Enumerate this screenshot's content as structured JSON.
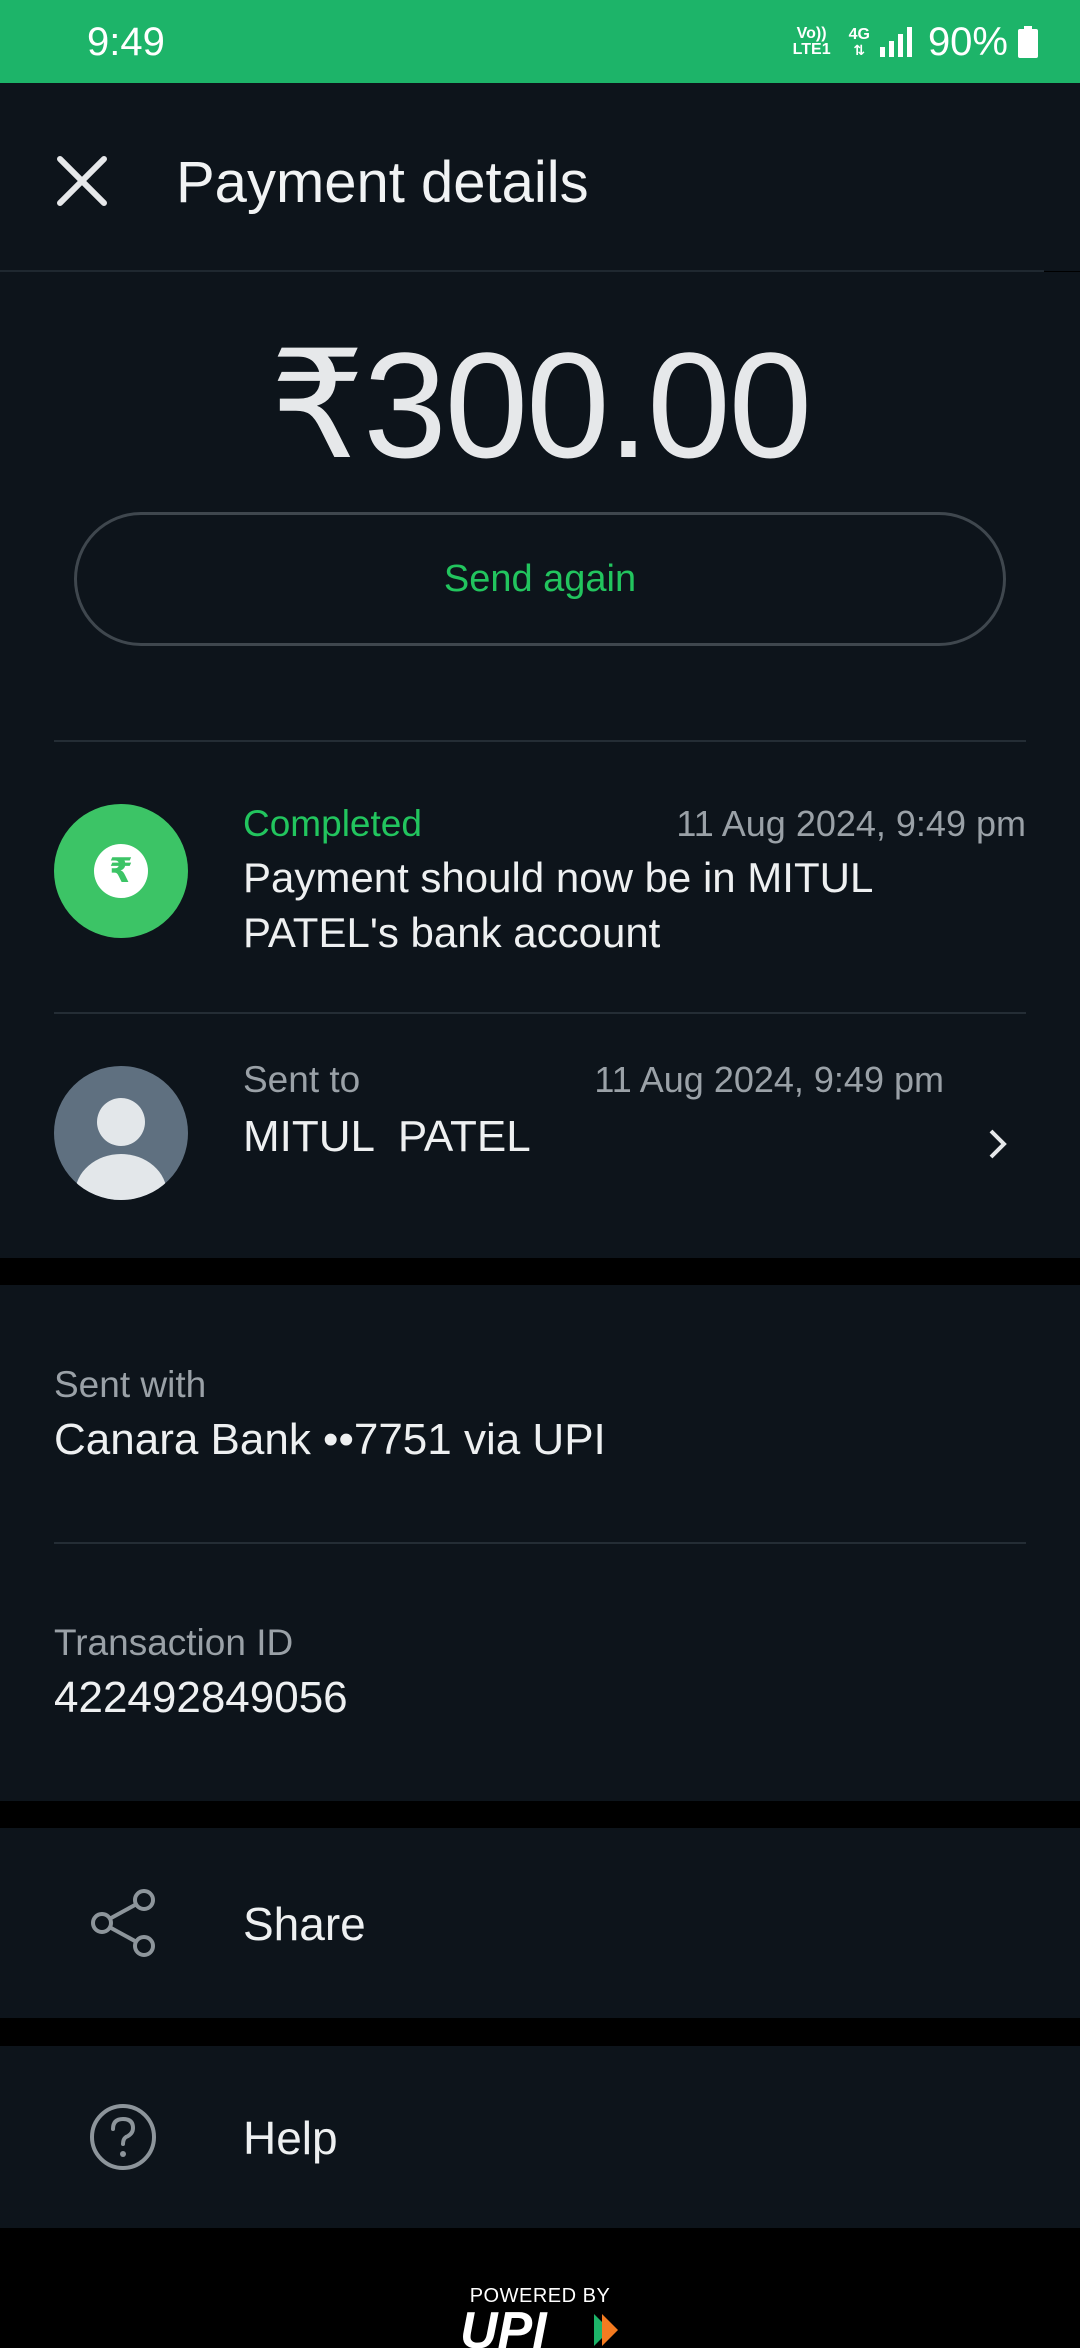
{
  "status_bar": {
    "time": "9:49",
    "volte_top": "Vo))",
    "volte_bottom": "LTE1",
    "network": "4G",
    "battery": "90%",
    "background_color": "#1db469"
  },
  "header": {
    "title": "Payment details",
    "close_icon": "close-icon"
  },
  "payment": {
    "amount": "₹300.00",
    "send_again_label": "Send again"
  },
  "status": {
    "label": "Completed",
    "date": "11 Aug 2024, 9:49 pm",
    "message": "Payment should now be in MITUL PATEL's bank account",
    "icon": "rupee-icon",
    "color": "#3cc466"
  },
  "recipient": {
    "label": "Sent to",
    "date": "11 Aug 2024, 9:49 pm",
    "name": "MITUL  PATEL",
    "avatar_icon": "person-avatar-icon"
  },
  "details": {
    "sent_with_label": "Sent with",
    "sent_with_value": "Canara Bank ••7751 via UPI",
    "transaction_label": "Transaction ID",
    "transaction_value": "422492849056"
  },
  "actions": {
    "share_label": "Share",
    "share_icon": "share-icon",
    "help_label": "Help",
    "help_icon": "help-icon"
  },
  "footer": {
    "powered_by": "POWERED BY",
    "logo": "UPI"
  }
}
